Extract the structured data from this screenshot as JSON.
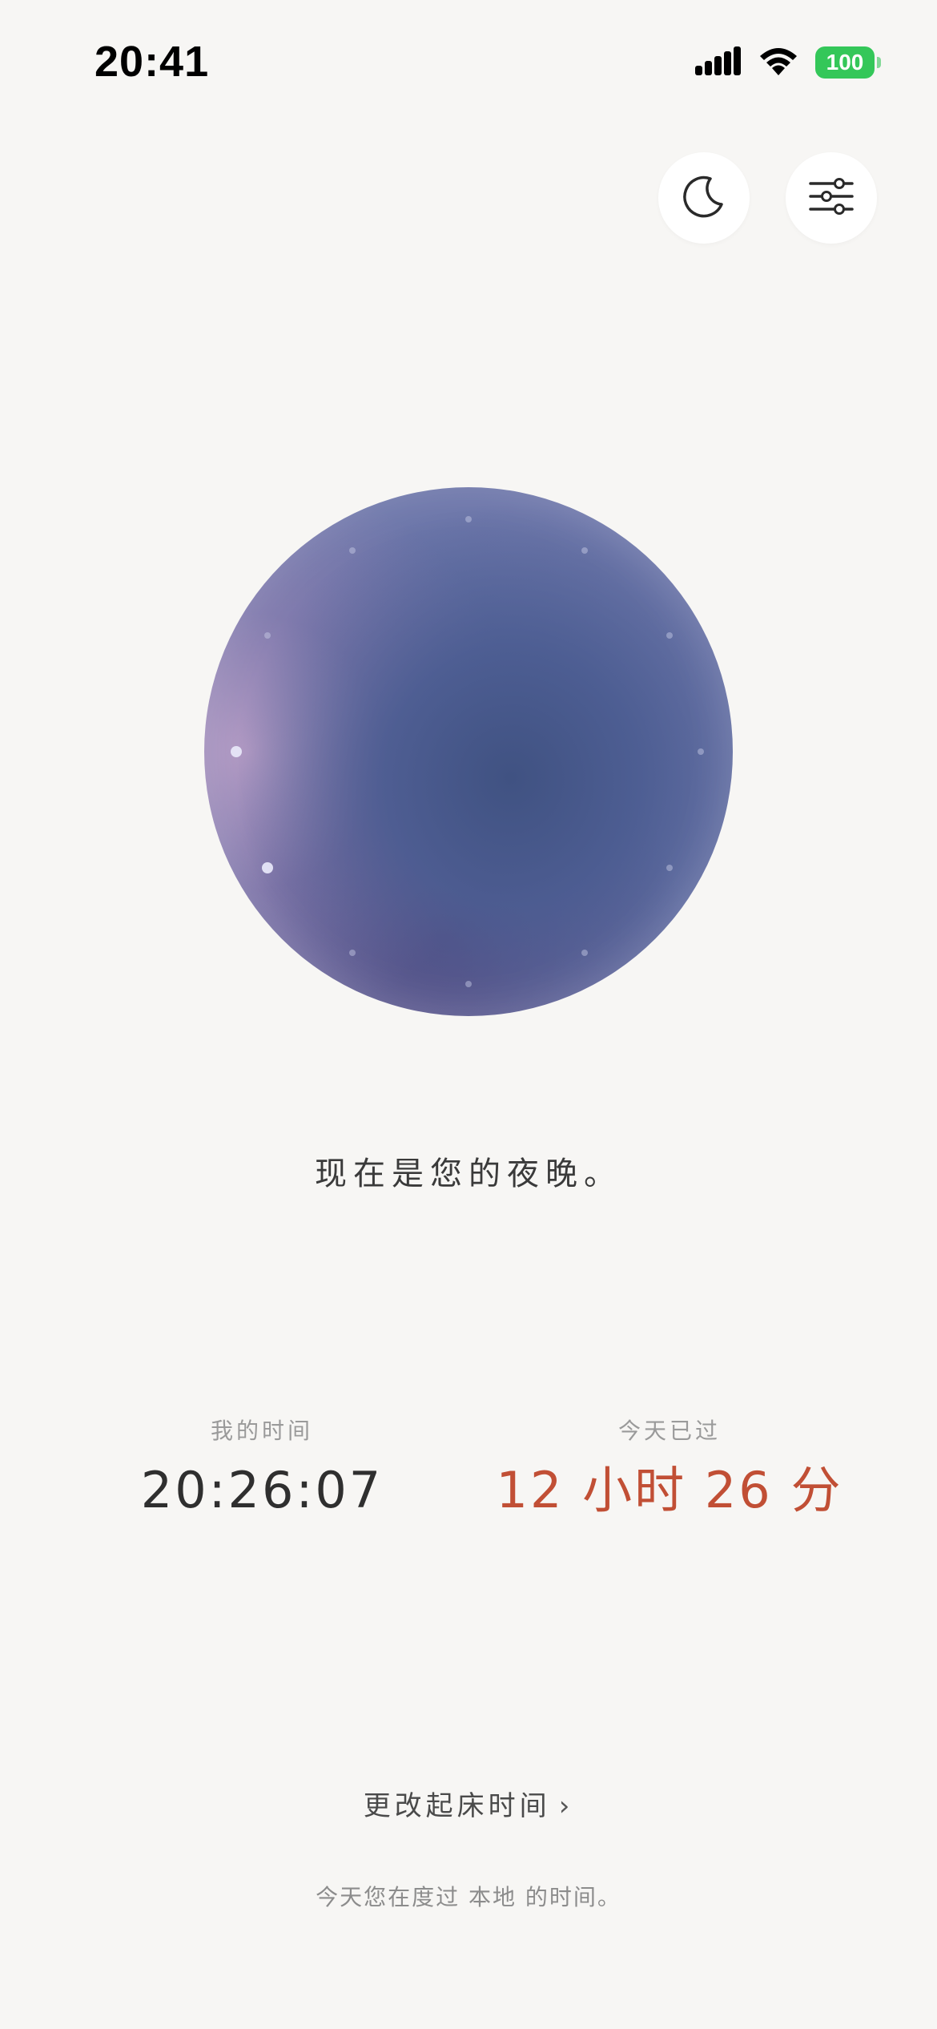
{
  "status_bar": {
    "time": "20:41",
    "battery": "100",
    "icons": [
      "signal-icon",
      "wifi-icon",
      "battery-icon"
    ],
    "battery_color": "#34c759"
  },
  "toolbar": {
    "buttons": [
      {
        "icon": "moon-icon"
      },
      {
        "icon": "sliders-icon"
      }
    ]
  },
  "orb": {
    "colors": [
      "#5a6aa0",
      "#9a92bd",
      "#405282"
    ]
  },
  "main": {
    "message": "现在是您的夜晚。"
  },
  "stats": {
    "my_time": {
      "label": "我的时间",
      "value": "20:26:07"
    },
    "elapsed": {
      "label": "今天已过",
      "value": "12 小时 26 分",
      "color": "#c14f35"
    }
  },
  "footer": {
    "change_link": "更改起床时间",
    "chevron": "›",
    "note": "今天您在度过 本地 的时间。"
  }
}
